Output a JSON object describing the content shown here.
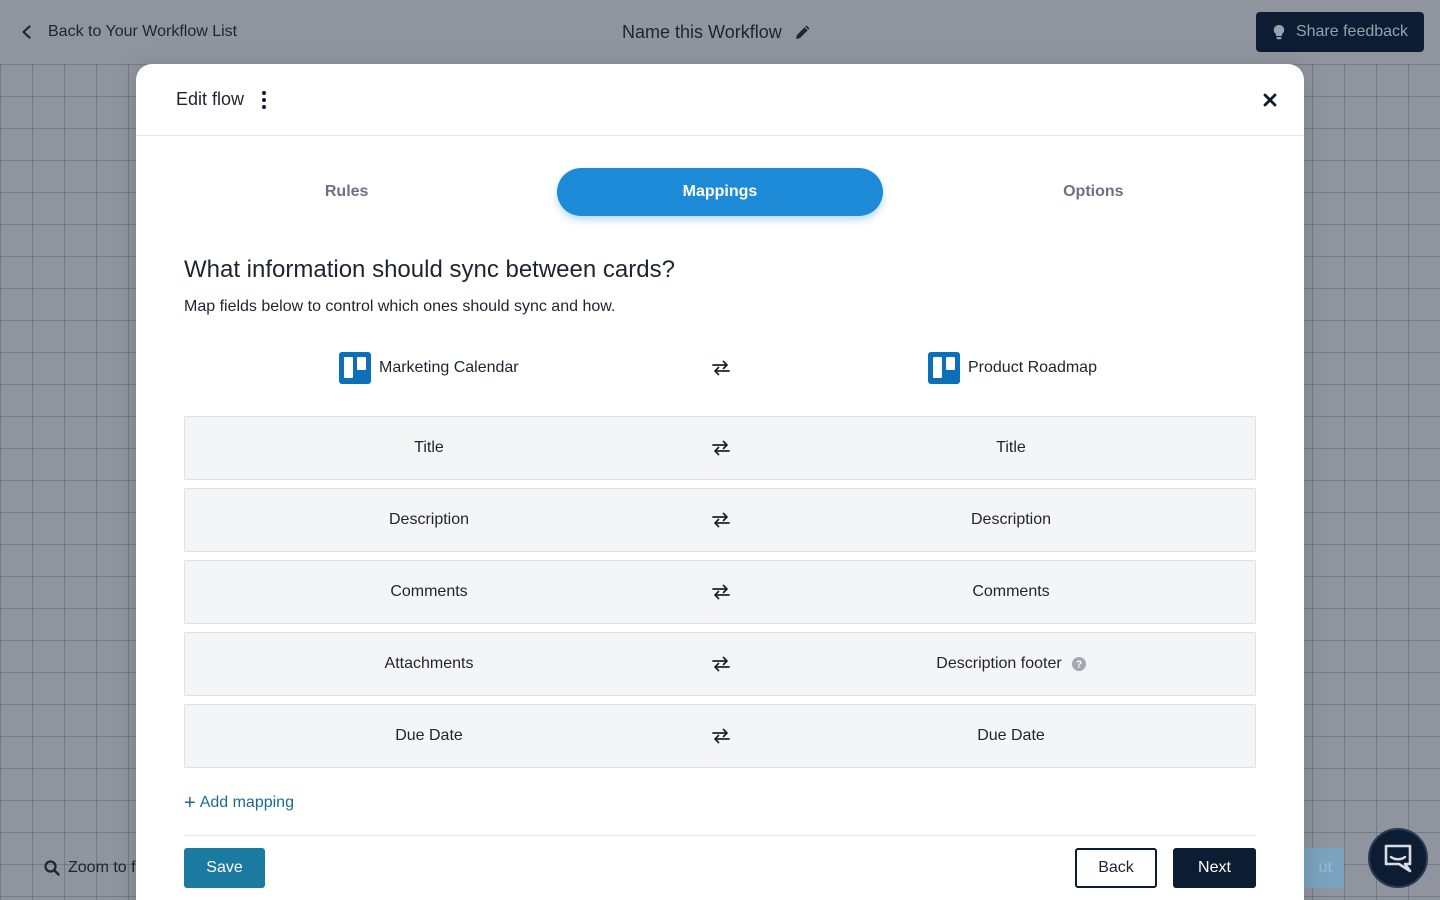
{
  "topbar": {
    "back_label": "Back to Your Workflow List",
    "workflow_name": "Name this Workflow",
    "share_feedback": "Share feedback"
  },
  "canvas": {
    "zoom_label": "Zoom to f",
    "ghost_button_label": "ut"
  },
  "modal": {
    "title": "Edit flow",
    "tabs": [
      {
        "label": "Rules",
        "active": false
      },
      {
        "label": "Mappings",
        "active": true
      },
      {
        "label": "Options",
        "active": false
      }
    ],
    "heading": "What information should sync between cards?",
    "subheading": "Map fields below to control which ones should sync and how.",
    "left_board": "Marketing Calendar",
    "right_board": "Product Roadmap",
    "mappings": [
      {
        "left": "Title",
        "right": "Title",
        "help": false
      },
      {
        "left": "Description",
        "right": "Description",
        "help": false
      },
      {
        "left": "Comments",
        "right": "Comments",
        "help": false
      },
      {
        "left": "Attachments",
        "right": "Description footer",
        "help": true
      },
      {
        "left": "Due Date",
        "right": "Due Date",
        "help": false
      }
    ],
    "add_mapping": "Add mapping",
    "save": "Save",
    "back": "Back",
    "next": "Next"
  },
  "colors": {
    "accent": "#1d8ad8",
    "navy": "#0c1c33",
    "save": "#1a7aa0",
    "trello": "#0c6fb8"
  }
}
